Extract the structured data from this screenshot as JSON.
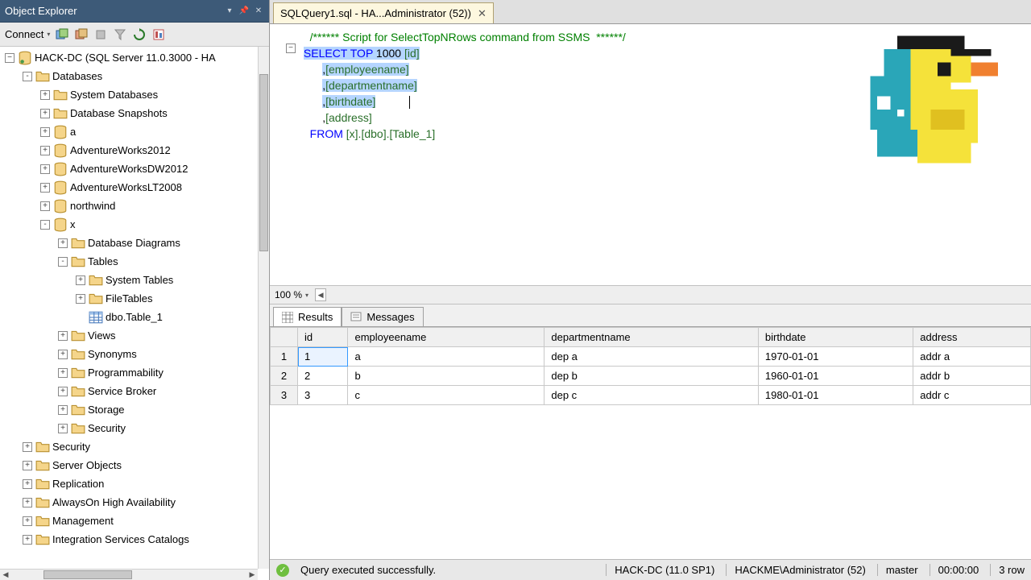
{
  "left": {
    "title": "Object Explorer",
    "connect_label": "Connect",
    "root": {
      "label": "HACK-DC (SQL Server 11.0.3000 - HA",
      "children": [
        {
          "label": "Databases",
          "exp": "-",
          "icon": "folder",
          "children": [
            {
              "label": "System Databases",
              "exp": "+",
              "icon": "folder"
            },
            {
              "label": "Database Snapshots",
              "exp": "+",
              "icon": "folder"
            },
            {
              "label": "a",
              "exp": "+",
              "icon": "db"
            },
            {
              "label": "AdventureWorks2012",
              "exp": "+",
              "icon": "db"
            },
            {
              "label": "AdventureWorksDW2012",
              "exp": "+",
              "icon": "db"
            },
            {
              "label": "AdventureWorksLT2008",
              "exp": "+",
              "icon": "db"
            },
            {
              "label": "northwind",
              "exp": "+",
              "icon": "db"
            },
            {
              "label": "x",
              "exp": "-",
              "icon": "db",
              "children": [
                {
                  "label": "Database Diagrams",
                  "exp": "+",
                  "icon": "folder"
                },
                {
                  "label": "Tables",
                  "exp": "-",
                  "icon": "folder",
                  "children": [
                    {
                      "label": "System Tables",
                      "exp": "+",
                      "icon": "folder"
                    },
                    {
                      "label": "FileTables",
                      "exp": "+",
                      "icon": "folder"
                    },
                    {
                      "label": "dbo.Table_1",
                      "exp": "",
                      "icon": "table"
                    }
                  ]
                },
                {
                  "label": "Views",
                  "exp": "+",
                  "icon": "folder"
                },
                {
                  "label": "Synonyms",
                  "exp": "+",
                  "icon": "folder"
                },
                {
                  "label": "Programmability",
                  "exp": "+",
                  "icon": "folder"
                },
                {
                  "label": "Service Broker",
                  "exp": "+",
                  "icon": "folder"
                },
                {
                  "label": "Storage",
                  "exp": "+",
                  "icon": "folder"
                },
                {
                  "label": "Security",
                  "exp": "+",
                  "icon": "folder"
                }
              ]
            }
          ]
        },
        {
          "label": "Security",
          "exp": "+",
          "icon": "folder"
        },
        {
          "label": "Server Objects",
          "exp": "+",
          "icon": "folder"
        },
        {
          "label": "Replication",
          "exp": "+",
          "icon": "folder"
        },
        {
          "label": "AlwaysOn High Availability",
          "exp": "+",
          "icon": "folder"
        },
        {
          "label": "Management",
          "exp": "+",
          "icon": "folder"
        },
        {
          "label": "Integration Services Catalogs",
          "exp": "+",
          "icon": "folder"
        }
      ]
    }
  },
  "tab": {
    "title": "SQLQuery1.sql - HA...Administrator (52))"
  },
  "editor": {
    "comment": "/****** Script for SelectTopNRows command from SSMS  ******/",
    "sql_parts": {
      "select": "SELECT",
      "top": "TOP",
      "topn": "1000",
      "cols": [
        "[id]",
        "[employeename]",
        "[departmentname]",
        "[birthdate]",
        "[address]"
      ],
      "from": "FROM",
      "table": "[x].[dbo].[Table_1]"
    },
    "zoom": "100 %"
  },
  "result_tabs": {
    "results": "Results",
    "messages": "Messages"
  },
  "grid": {
    "columns": [
      "id",
      "employeename",
      "departmentname",
      "birthdate",
      "address"
    ],
    "rows": [
      {
        "n": "1",
        "id": "1",
        "employeename": "a",
        "departmentname": "dep a",
        "birthdate": "1970-01-01",
        "address": "addr a"
      },
      {
        "n": "2",
        "id": "2",
        "employeename": "b",
        "departmentname": "dep b",
        "birthdate": "1960-01-01",
        "address": "addr b"
      },
      {
        "n": "3",
        "id": "3",
        "employeename": "c",
        "departmentname": "dep c",
        "birthdate": "1980-01-01",
        "address": "addr c"
      }
    ]
  },
  "status": {
    "msg": "Query executed successfully.",
    "server": "HACK-DC (11.0 SP1)",
    "user": "HACKME\\Administrator (52)",
    "db": "master",
    "time": "00:00:00",
    "rows": "3 row"
  }
}
